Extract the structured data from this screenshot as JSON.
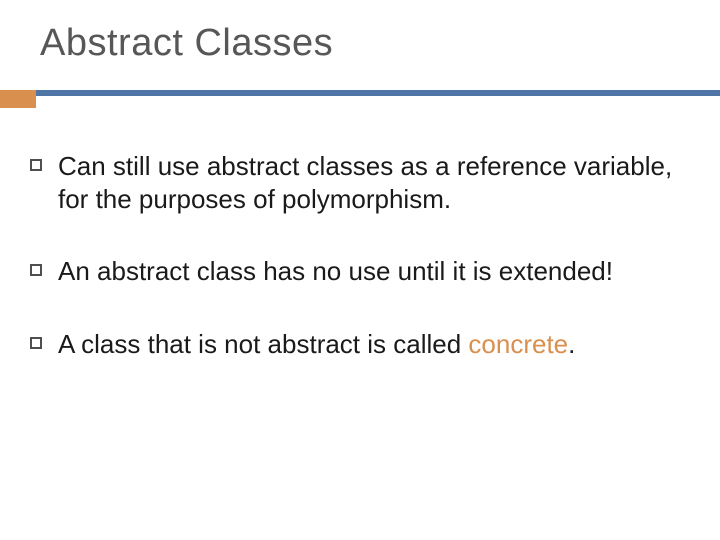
{
  "title": "Abstract Classes",
  "bullets": [
    {
      "segments": [
        {
          "text": "Can still use abstract classes as a reference variable, for the purposes of polymorphism.",
          "accent": false
        }
      ]
    },
    {
      "segments": [
        {
          "text": "An abstract class has no use until it is extended!",
          "accent": false
        }
      ]
    },
    {
      "segments": [
        {
          "text": "A class that is not abstract is called ",
          "accent": false
        },
        {
          "text": "concrete",
          "accent": true
        },
        {
          "text": ".",
          "accent": false
        }
      ]
    }
  ]
}
